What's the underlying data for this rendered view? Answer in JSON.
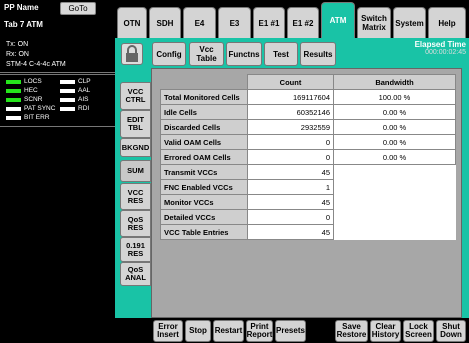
{
  "header": {
    "title": "PP Name",
    "goto": "GoTo",
    "subtitle": "Tab 7 ATM"
  },
  "status": {
    "tx": "Tx: ON",
    "rx": "Rx: ON",
    "interface": "STM-4 C-4-4c ATM",
    "indicators_left": [
      "LOCS",
      "HEC",
      "SCNR",
      "PAT SYNC",
      "BIT ERR"
    ],
    "indicators_right": [
      "CLP",
      "AAL",
      "AIS",
      "RDI"
    ],
    "led_green_color": "#26e51c"
  },
  "tabs": [
    "OTN",
    "SDH",
    "E4",
    "E3",
    "E1 #1",
    "E1 #2",
    "ATM",
    "Switch Matrix",
    "System",
    "Help"
  ],
  "active_tab": "ATM",
  "accent_color": "#19c3a6",
  "toolbar": {
    "lock_icon": "lock-icon",
    "buttons": [
      "Config",
      "Vcc Table",
      "Functns",
      "Test",
      "Results"
    ],
    "elapsed_label": "Elapsed Time",
    "elapsed_value": "000:00:02:45"
  },
  "side_tabs": [
    "VCC CTRL",
    "EDIT TBL",
    "BKGND",
    "SUM",
    "VCC RES",
    "QoS RES",
    "0.191 RES",
    "QoS ANAL"
  ],
  "table": {
    "headers": [
      "",
      "Count",
      "Bandwidth"
    ],
    "rows": [
      {
        "label": "Total Monitored Cells",
        "count": "169117604",
        "bw": "100.00 %"
      },
      {
        "label": "Idle Cells",
        "count": "60352146",
        "bw": "0.00 %"
      },
      {
        "label": "Discarded Cells",
        "count": "2932559",
        "bw": "0.00 %"
      },
      {
        "label": "Valid OAM Cells",
        "count": "0",
        "bw": "0.00 %"
      },
      {
        "label": "Errored OAM Cells",
        "count": "0",
        "bw": "0.00 %"
      },
      {
        "label": "Transmit VCCs",
        "count": "45",
        "bw": ""
      },
      {
        "label": "FNC Enabled VCCs",
        "count": "1",
        "bw": ""
      },
      {
        "label": "Monitor VCCs",
        "count": "45",
        "bw": ""
      },
      {
        "label": "Detailed VCCs",
        "count": "0",
        "bw": ""
      },
      {
        "label": "VCC Table Entries",
        "count": "45",
        "bw": ""
      }
    ]
  },
  "bottom": [
    "Error Insert",
    "Stop",
    "Restart",
    "Print Report",
    "Presets",
    "Save Restore",
    "Clear History",
    "Lock Screen",
    "Shut Down"
  ]
}
